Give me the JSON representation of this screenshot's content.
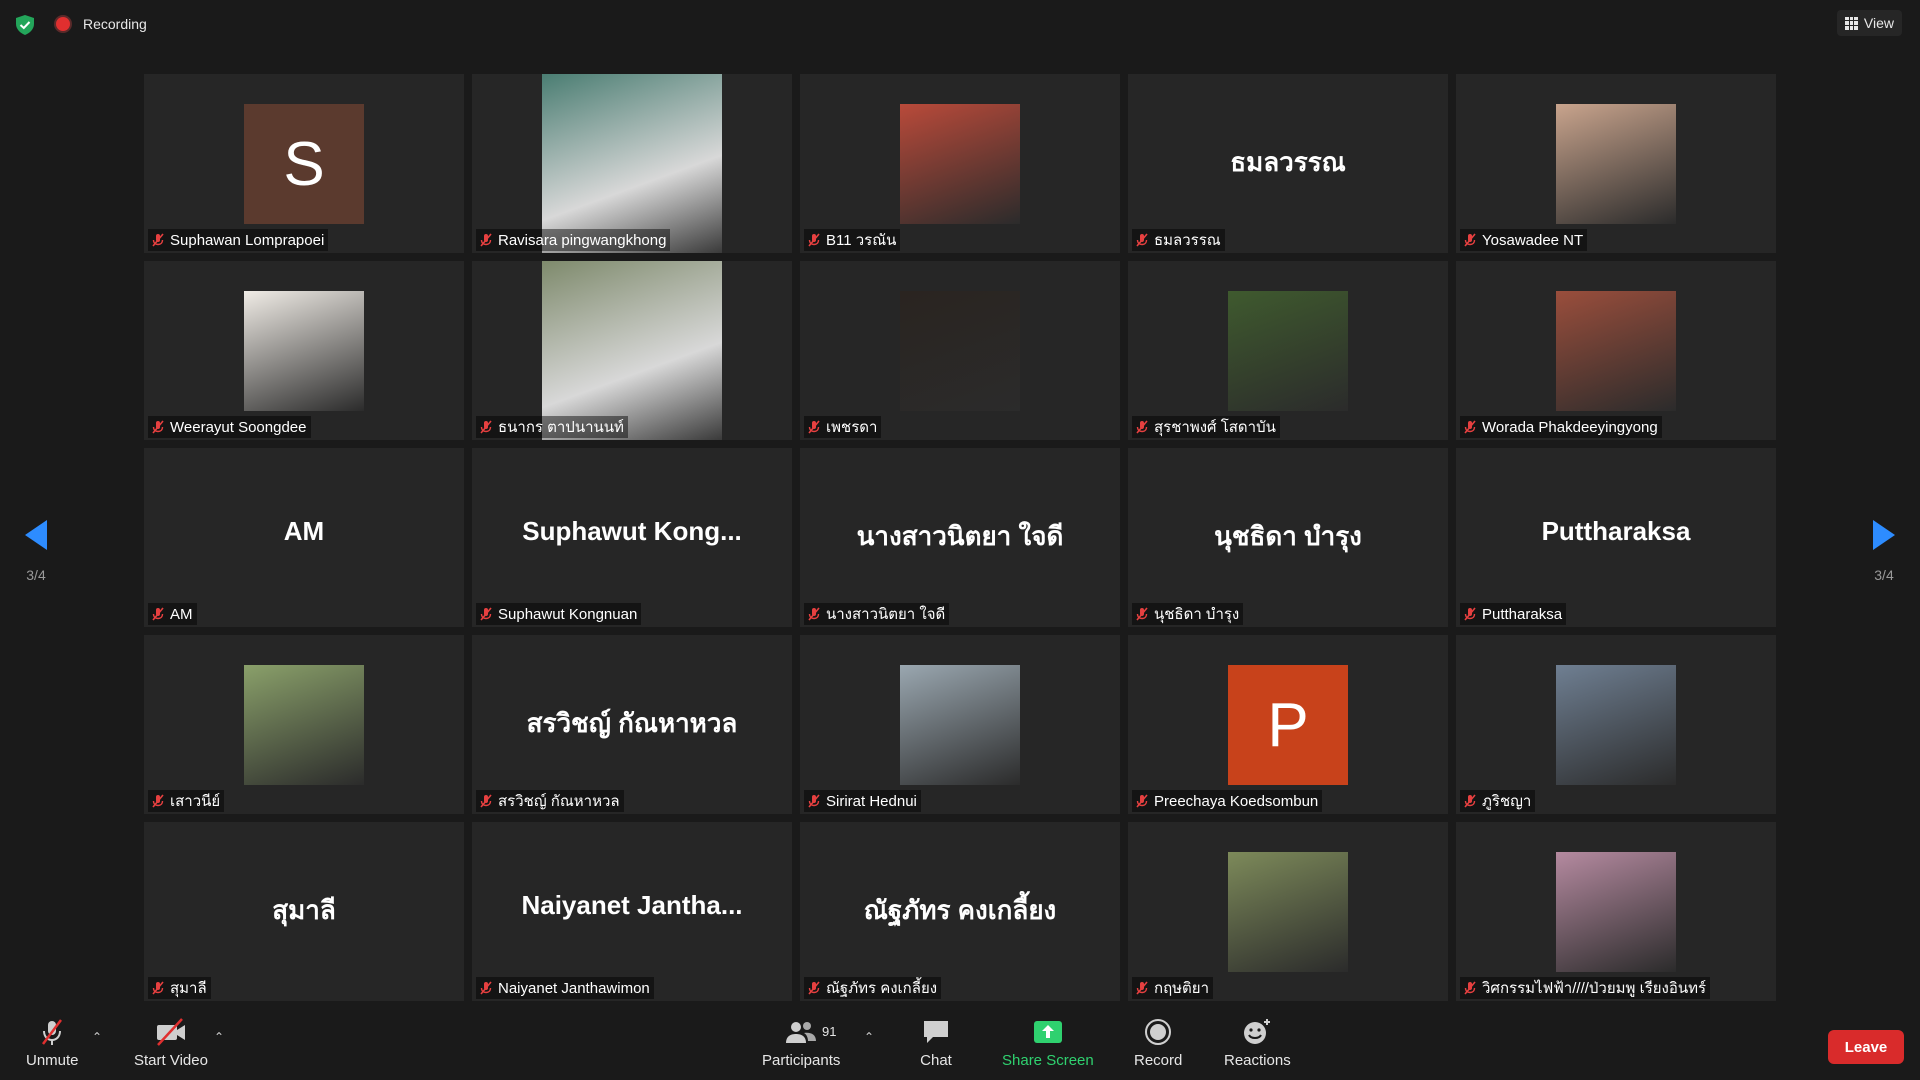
{
  "topbar": {
    "recording_label": "Recording",
    "view_label": "View"
  },
  "gallery": {
    "page_indicator_left": "3/4",
    "page_indicator_right": "3/4",
    "participants": [
      {
        "name": "Suphawan Lomprapoei",
        "type": "letter",
        "letter": "S",
        "letter_bg": "#5b3a2e"
      },
      {
        "name": "Ravisara pingwangkhong",
        "type": "photo-tall",
        "photo_bg": "#4a7d72"
      },
      {
        "name": "B11 วรณัน",
        "type": "photo",
        "photo_bg": "#b94a3a"
      },
      {
        "name": "ธมลวรรณ",
        "type": "text",
        "display": "ธมลวรรณ"
      },
      {
        "name": "Yosawadee NT",
        "type": "photo",
        "photo_bg": "#c9a48d"
      },
      {
        "name": "Weerayut Soongdee",
        "type": "photo",
        "photo_bg": "#f0ece6"
      },
      {
        "name": "ธนากร ตาปนานนท์",
        "type": "photo-tall",
        "photo_bg": "#7e8a6c"
      },
      {
        "name": "เพชรดา",
        "type": "photo",
        "photo_bg": "#2a2420"
      },
      {
        "name": "สุรชาพงศ์ โสดาบัน",
        "type": "photo",
        "photo_bg": "#3f5a2e"
      },
      {
        "name": "Worada Phakdeeyingyong",
        "type": "photo",
        "photo_bg": "#9a4e3c"
      },
      {
        "name": "AM",
        "type": "text",
        "display": "AM"
      },
      {
        "name": "Suphawut Kongnuan",
        "type": "text",
        "display": "Suphawut  Kong..."
      },
      {
        "name": "นางสาวนิตยา ใจดี",
        "type": "text",
        "display": "นางสาวนิตยา ใจดี"
      },
      {
        "name": "นุชธิดา บำรุง",
        "type": "text",
        "display": "นุชธิดา บำรุง"
      },
      {
        "name": "Puttharaksa",
        "type": "text",
        "display": "Puttharaksa"
      },
      {
        "name": "เสาวนีย์",
        "type": "photo",
        "photo_bg": "#8aa06a"
      },
      {
        "name": "สรวิชญ์ กัณหาหวล",
        "type": "text",
        "display": "สรวิชญ์ กัณหาหวล"
      },
      {
        "name": "Sirirat Hednui",
        "type": "photo",
        "photo_bg": "#9aa7b0"
      },
      {
        "name": "Preechaya Koedsombun",
        "type": "letter",
        "letter": "P",
        "letter_bg": "#c8421b"
      },
      {
        "name": "ภูริชญา",
        "type": "photo",
        "photo_bg": "#6f7f92"
      },
      {
        "name": "สุมาลี",
        "type": "text",
        "display": "สุมาลี"
      },
      {
        "name": "Naiyanet Janthawimon",
        "type": "text",
        "display": "Naiyanet  Jantha..."
      },
      {
        "name": "ณัฐภัทร คงเกลี้ยง",
        "type": "text",
        "display": "ณัฐภัทร คงเกลี้ยง"
      },
      {
        "name": "กฤษติยา",
        "type": "photo",
        "photo_bg": "#7d8a5a"
      },
      {
        "name": "วิศกรรมไฟฟ้า////ป่วยมพู เรียงอินทร์",
        "type": "photo",
        "photo_bg": "#b58aa0"
      }
    ]
  },
  "toolbar": {
    "unmute_label": "Unmute",
    "start_video_label": "Start Video",
    "participants_label": "Participants",
    "participants_count": "91",
    "chat_label": "Chat",
    "share_screen_label": "Share Screen",
    "record_label": "Record",
    "reactions_label": "Reactions",
    "leave_label": "Leave"
  },
  "colors": {
    "background": "#1a1a1a",
    "tile": "#262626",
    "accent_blue": "#2d8cff",
    "share_green": "#2fd16f",
    "leave_red": "#d92b2b"
  }
}
